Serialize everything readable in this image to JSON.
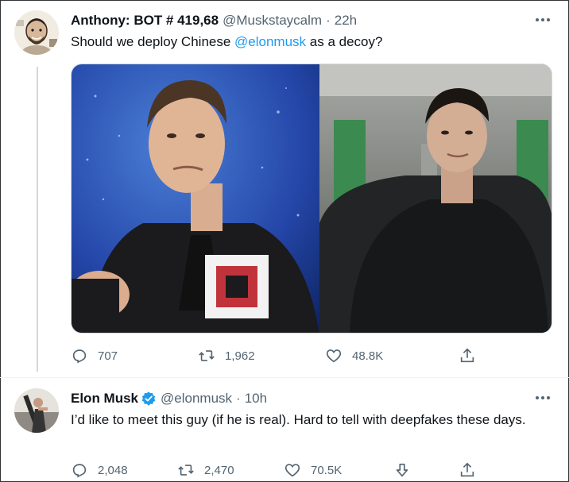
{
  "tweet1": {
    "name": "Anthony: BOT # 419,68",
    "handle": "@Muskstaycalm",
    "dot": "·",
    "time": "22h",
    "text_before": "Should we deploy Chinese ",
    "mention": "@elonmusk",
    "text_after": " as a decoy?",
    "stats": {
      "replies": "707",
      "retweets": "1,962",
      "likes": "48.8K"
    }
  },
  "tweet2": {
    "name": "Elon Musk",
    "handle": "@elonmusk",
    "dot": "·",
    "time": "10h",
    "text": "I’d like to meet this guy (if he is real). Hard to tell with deepfakes these days.",
    "stats": {
      "replies": "2,048",
      "retweets": "2,470",
      "likes": "70.5K"
    }
  },
  "colors": {
    "accent": "#1d9bf0",
    "secondary_text": "#536471",
    "primary_text": "#0f1419"
  },
  "icons": [
    "more-icon",
    "reply-icon",
    "retweet-icon",
    "like-icon",
    "share-icon",
    "downvote-icon",
    "verified-badge-icon"
  ]
}
